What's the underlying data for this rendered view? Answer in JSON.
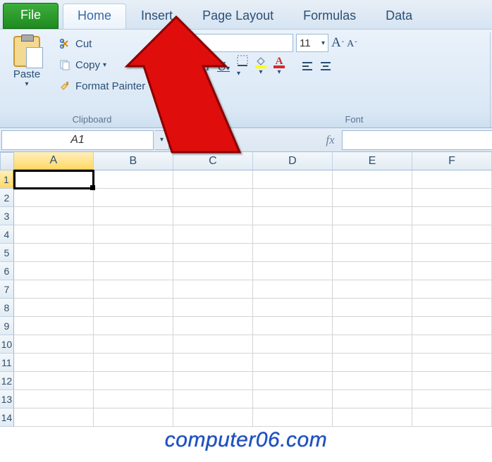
{
  "tabs": {
    "file": "File",
    "home": "Home",
    "insert": "Insert",
    "page_layout": "Page Layout",
    "formulas": "Formulas",
    "data": "Data"
  },
  "clipboard": {
    "paste": "Paste",
    "cut": "Cut",
    "copy": "Copy",
    "format_painter": "Format Painter",
    "group_label": "Clipboard"
  },
  "font": {
    "size_value": "11",
    "group_label": "Font"
  },
  "namebox": {
    "value": "A1"
  },
  "formula_bar": {
    "fx": "fx"
  },
  "columns": [
    "A",
    "B",
    "C",
    "D",
    "E",
    "F"
  ],
  "rows": [
    "1",
    "2",
    "3",
    "4",
    "5",
    "6",
    "7",
    "8",
    "9",
    "10",
    "11",
    "12",
    "13",
    "14"
  ],
  "active_cell": {
    "row": 0,
    "col": 0
  },
  "watermark": "computer06.com"
}
